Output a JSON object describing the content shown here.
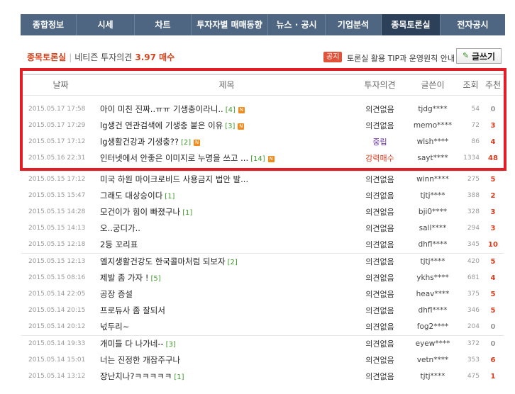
{
  "nav": {
    "tabs": [
      {
        "label": "종합정보",
        "active": false,
        "w": 79
      },
      {
        "label": "시세",
        "active": false,
        "w": 82
      },
      {
        "label": "차트",
        "active": false,
        "w": 80
      },
      {
        "label": "투자자별 매매동향",
        "active": false,
        "w": 108
      },
      {
        "label": "뉴스 · 공시",
        "active": false,
        "w": 81
      },
      {
        "label": "기업분석",
        "active": false,
        "w": 79
      },
      {
        "label": "종목토론실",
        "active": true,
        "w": 83
      },
      {
        "label": "전자공시",
        "active": false,
        "w": 91
      }
    ]
  },
  "header": {
    "title": "종목토론실",
    "label": "네티즌 투자의견",
    "score": "3.97 매수",
    "notice_badge": "공지",
    "notice_text": "토론실 활용 TIP과 운영원칙 안내",
    "write_button": "글쓰기"
  },
  "table": {
    "columns": {
      "date": "날짜",
      "title": "제목",
      "opinion": "투자의견",
      "author": "글쓴이",
      "views": "조회",
      "rec": "추천"
    },
    "highlighted_rows": [
      {
        "date": "2015.05.17 17:58",
        "title": "아이 미친 진짜..ㅠㅠ 기생충이라니..",
        "comments": "[4]",
        "new": true,
        "opinion": "의견없음",
        "author": "tjdg****",
        "views": "54",
        "rec": "0"
      },
      {
        "date": "2015.05.17 17:29",
        "title": "lg생건 연관검색에 기생충 붙은 이유",
        "comments": "[3]",
        "new": true,
        "opinion": "의견없음",
        "author": "memo****",
        "views": "72",
        "rec": "3"
      },
      {
        "date": "2015.05.17 17:12",
        "title": "lg생활건강과 기생충??",
        "comments": "[2]",
        "new": true,
        "opinion": "중립",
        "author": "wlsh****",
        "views": "86",
        "rec": "4"
      },
      {
        "date": "2015.05.16 22:31",
        "title": "인터넷에서 안좋은 이미지로 누명을 쓰고 ...",
        "comments": "[14]",
        "new": true,
        "opinion": "강력매수",
        "author": "sayt****",
        "views": "1334",
        "rec": "48"
      }
    ],
    "rows": [
      {
        "date": "2015.05.15 17:12",
        "title": "미국 하원 마이크로비드 사용금지 법안 발...",
        "comments": "",
        "opinion": "의견없음",
        "author": "winn****",
        "views": "275",
        "rec": "5",
        "group_first": true
      },
      {
        "date": "2015.05.15 15:47",
        "title": "그래도 대상승이다",
        "comments": "[1]",
        "opinion": "의견없음",
        "author": "tjtj****",
        "views": "388",
        "rec": "2"
      },
      {
        "date": "2015.05.15 14:28",
        "title": "모건이가 힘이 빠졌구나",
        "comments": "[1]",
        "opinion": "의견없음",
        "author": "bji0****",
        "views": "328",
        "rec": "3"
      },
      {
        "date": "2015.05.15 14:13",
        "title": "오..궁디가..",
        "comments": "",
        "opinion": "의견없음",
        "author": "sall****",
        "views": "294",
        "rec": "3"
      },
      {
        "date": "2015.05.15 12:18",
        "title": "2등 꼬리표",
        "comments": "",
        "opinion": "의견없음",
        "author": "dhfl****",
        "views": "345",
        "rec": "10"
      },
      {
        "date": "2015.05.15 12:13",
        "title": "엘지생활건강도 한국콜마처럼 되보자",
        "comments": "[2]",
        "opinion": "의견없음",
        "author": "tjtj****",
        "views": "420",
        "rec": "5",
        "group_first": true
      },
      {
        "date": "2015.05.15 08:16",
        "title": "제발 좀 가자 !",
        "comments": "[5]",
        "opinion": "의견없음",
        "author": "ykhs****",
        "views": "681",
        "rec": "4"
      },
      {
        "date": "2015.05.14 22:05",
        "title": "공장 증설",
        "comments": "",
        "opinion": "의견없음",
        "author": "heav****",
        "views": "375",
        "rec": "5"
      },
      {
        "date": "2015.05.14 20:15",
        "title": "프로듀사 좀 잘되서",
        "comments": "",
        "opinion": "의견없음",
        "author": "dhfl****",
        "views": "346",
        "rec": "5"
      },
      {
        "date": "2015.05.14 20:12",
        "title": "넋두리~",
        "comments": "",
        "opinion": "의견없음",
        "author": "fog2****",
        "views": "204",
        "rec": "0"
      },
      {
        "date": "2015.05.14 19:33",
        "title": "개미들 다 나가네--",
        "comments": "[3]",
        "opinion": "의견없음",
        "author": "eyew****",
        "views": "372",
        "rec": "0",
        "group_first": true
      },
      {
        "date": "2015.05.14 15:01",
        "title": "너는 진정한 개잡주구나",
        "comments": "",
        "opinion": "의견없음",
        "author": "vetn****",
        "views": "353",
        "rec": "6"
      },
      {
        "date": "2015.05.14 13:12",
        "title": "장난치나?ㅋㅋㅋㅋㅋ",
        "comments": "[1]",
        "opinion": "의견없음",
        "author": "tjtj****",
        "views": "475",
        "rec": "1"
      }
    ]
  },
  "colors": {
    "nav_bg": "#4e6682",
    "nav_active": "#2c405a",
    "accent_red": "#d43c1d",
    "highlight": "#e31d25",
    "comment_green": "#3e9a2a",
    "neutral_purple": "#6a2ea7"
  },
  "icons": {
    "new_badge": "new-icon",
    "write": "pencil-icon"
  }
}
